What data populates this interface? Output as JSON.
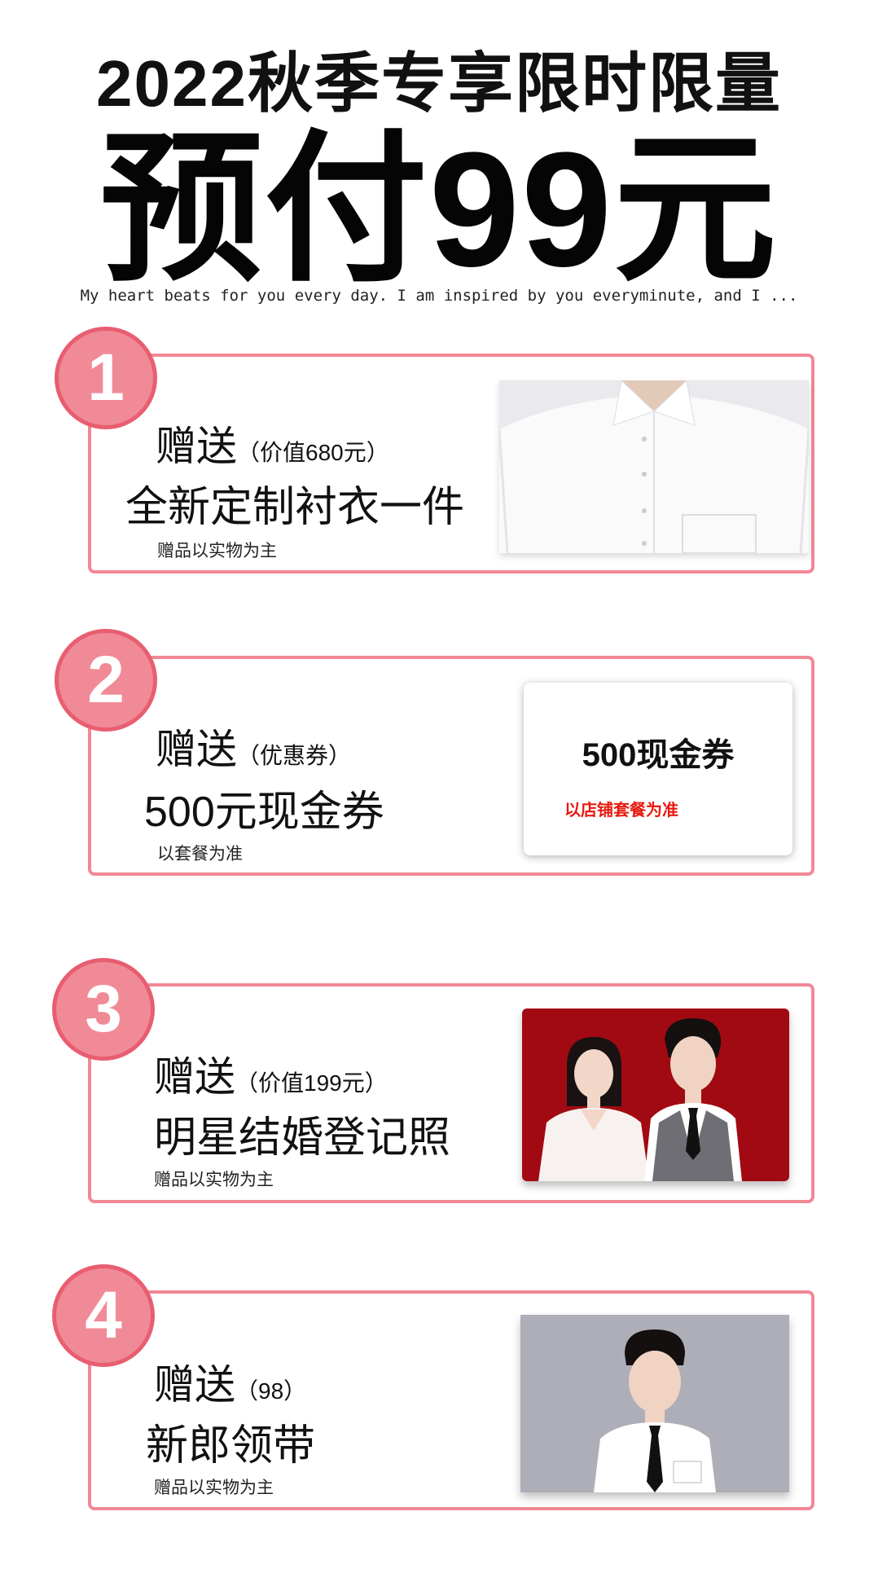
{
  "header": {
    "title": "2022秋季专享限时限量",
    "headline": "预付99元",
    "slogan": "My heart beats for you every day. I am inspired by you everyminute, and I ..."
  },
  "items": [
    {
      "number": "1",
      "gift": "赠送",
      "gift_note": "（价值680元）",
      "name": "全新定制衬衣一件",
      "sub": "赠品以实物为主",
      "image": "white-shirt-photo"
    },
    {
      "number": "2",
      "gift": "赠送",
      "gift_note": "（优惠券）",
      "name": "500元现金券",
      "sub": "以套餐为准",
      "coupon": {
        "title": "500现金券",
        "note": "以店铺套餐为准"
      }
    },
    {
      "number": "3",
      "gift": "赠送",
      "gift_note": "（价值199元）",
      "name": "明星结婚登记照",
      "sub": "赠品以实物为主",
      "image": "wedding-registration-photo"
    },
    {
      "number": "4",
      "gift": "赠送",
      "gift_note": "（98）",
      "name": "新郎领带",
      "sub": "赠品以实物为主",
      "image": "groom-tie-photo"
    }
  ],
  "colors": {
    "accent": "#f28895",
    "badge_border": "#e85e70",
    "coupon_note": "#e8190f",
    "wedding_bg": "#a10a12"
  }
}
